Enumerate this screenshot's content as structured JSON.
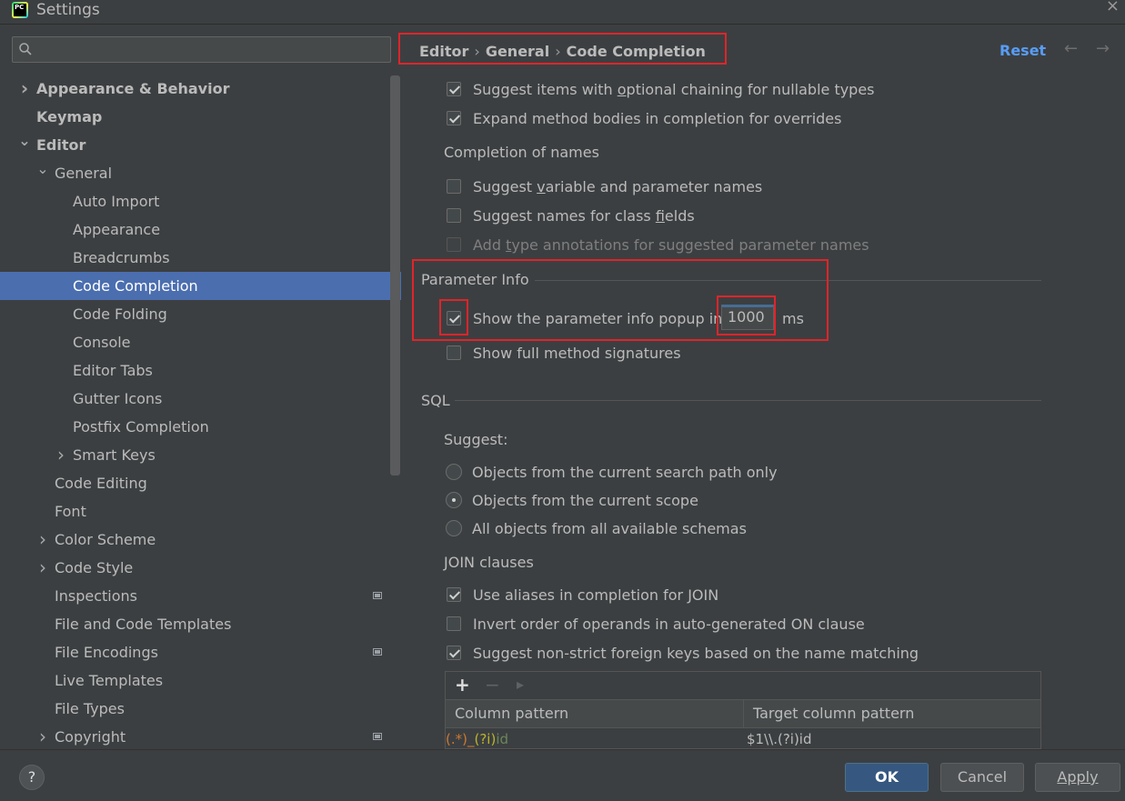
{
  "window": {
    "title": "Settings",
    "logo": "PC"
  },
  "search": {
    "placeholder": "",
    "value": ""
  },
  "tree": [
    {
      "label": "Appearance & Behavior",
      "level": 0,
      "chevron": "right",
      "bold": true
    },
    {
      "label": "Keymap",
      "level": 0,
      "chevron": "",
      "bold": true
    },
    {
      "label": "Editor",
      "level": 0,
      "chevron": "down",
      "bold": true
    },
    {
      "label": "General",
      "level": 1,
      "chevron": "down"
    },
    {
      "label": "Auto Import",
      "level": 2,
      "chevron": ""
    },
    {
      "label": "Appearance",
      "level": 2,
      "chevron": ""
    },
    {
      "label": "Breadcrumbs",
      "level": 2,
      "chevron": ""
    },
    {
      "label": "Code Completion",
      "level": 2,
      "chevron": "",
      "selected": true
    },
    {
      "label": "Code Folding",
      "level": 2,
      "chevron": ""
    },
    {
      "label": "Console",
      "level": 2,
      "chevron": ""
    },
    {
      "label": "Editor Tabs",
      "level": 2,
      "chevron": ""
    },
    {
      "label": "Gutter Icons",
      "level": 2,
      "chevron": ""
    },
    {
      "label": "Postfix Completion",
      "level": 2,
      "chevron": ""
    },
    {
      "label": "Smart Keys",
      "level": 2,
      "chevron": "right"
    },
    {
      "label": "Code Editing",
      "level": 1,
      "chevron": ""
    },
    {
      "label": "Font",
      "level": 1,
      "chevron": ""
    },
    {
      "label": "Color Scheme",
      "level": 1,
      "chevron": "right"
    },
    {
      "label": "Code Style",
      "level": 1,
      "chevron": "right"
    },
    {
      "label": "Inspections",
      "level": 1,
      "chevron": "",
      "projectIcon": true
    },
    {
      "label": "File and Code Templates",
      "level": 1,
      "chevron": ""
    },
    {
      "label": "File Encodings",
      "level": 1,
      "chevron": "",
      "projectIcon": true
    },
    {
      "label": "Live Templates",
      "level": 1,
      "chevron": ""
    },
    {
      "label": "File Types",
      "level": 1,
      "chevron": ""
    },
    {
      "label": "Copyright",
      "level": 1,
      "chevron": "right",
      "projectIcon": true
    }
  ],
  "breadcrumb": {
    "editor": "Editor",
    "general": "General",
    "current": "Code Completion",
    "separator": "›"
  },
  "header": {
    "reset": "Reset",
    "back_icon": "arrow-left-icon",
    "forward_icon": "arrow-right-icon"
  },
  "options": {
    "optional_chaining": {
      "pre": "Suggest items with ",
      "u": "o",
      "post": "ptional chaining for nullable types",
      "checked": true
    },
    "expand_bodies": {
      "text": "Expand method bodies in completion for overrides",
      "checked": true
    },
    "names_title": "Completion of names",
    "variable_names": {
      "pre": "Suggest ",
      "u": "v",
      "post": "ariable and parameter names",
      "checked": false
    },
    "class_fields": {
      "pre": "Suggest names for class ",
      "u": "f",
      "post": "ields",
      "checked": false
    },
    "type_annotations": {
      "pre": "Add ",
      "u": "t",
      "post": "ype annotations for suggested parameter names",
      "checked": false,
      "disabled": true
    }
  },
  "param_info": {
    "title": "Parameter Info",
    "popup_label": "Show the parameter info popup in",
    "popup_checked": true,
    "popup_delay": "1000",
    "unit": "ms",
    "full_signatures": {
      "text": "Show full method signatures",
      "checked": false
    }
  },
  "sql": {
    "title": "SQL",
    "suggest_label": "Suggest:",
    "radios": [
      {
        "text": "Objects from the current search path only",
        "selected": false
      },
      {
        "text": "Objects from the current scope",
        "selected": true
      },
      {
        "text": "All objects from all available schemas",
        "selected": false
      }
    ],
    "join_title": "JOIN clauses",
    "join_options": [
      {
        "text": "Use aliases in completion for JOIN",
        "checked": true
      },
      {
        "text": "Invert order of operands in auto-generated ON clause",
        "checked": false
      },
      {
        "text": "Suggest non-strict foreign keys based on the name matching",
        "checked": true
      }
    ],
    "table": {
      "toolbar": {
        "add": "+",
        "remove": "−",
        "move": "▸"
      },
      "columns": [
        "Column pattern",
        "Target column pattern"
      ],
      "rows": [
        {
          "pattern_parts": [
            "(.*)_",
            "(?i)",
            "id"
          ],
          "target": "$1\\\\.(?i)id"
        }
      ]
    }
  },
  "footer": {
    "help": "?",
    "ok": "OK",
    "cancel": "Cancel",
    "apply": "Apply"
  },
  "colors": {
    "accent": "#4b6eaf",
    "link": "#589df6",
    "highlight": "#e0242a",
    "regex_group": "#cc7832",
    "regex_flag": "#bbb529",
    "regex_literal": "#6a8759"
  }
}
